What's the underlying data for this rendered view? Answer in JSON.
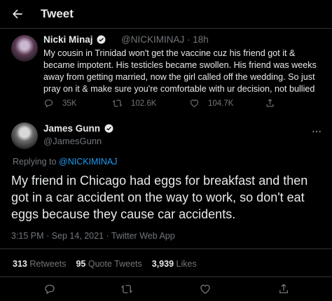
{
  "header": {
    "title": "Tweet",
    "back_icon": "back-arrow-icon"
  },
  "parent_tweet": {
    "author_name": "Nicki Minaj",
    "handle": "@NICKIMINAJ",
    "time": "· 18h",
    "text": "My cousin in Trinidad won't get the vaccine cuz his friend got it & became impotent. His testicles became swollen. His friend was weeks away from getting married, now the girl called off the wedding. So just pray on it & make sure you're comfortable with ur decision, not bullied",
    "replies": "35K",
    "retweets": "102.6K",
    "likes": "104.7K"
  },
  "main_tweet": {
    "author_name": "James Gunn",
    "handle": "@JamesGunn",
    "replying_prefix": "Replying to ",
    "replying_to": "@NICKIMINAJ",
    "text": "My friend in Chicago had eggs for breakfast and then got in a car accident on the way to work, so don't eat eggs because they cause car accidents.",
    "timestamp": "3:15 PM · Sep 14, 2021 · Twitter Web App",
    "retweets_count": "313",
    "retweets_label": "Retweets",
    "quote_count": "95",
    "quote_label": "Quote Tweets",
    "likes_count": "3,939",
    "likes_label": "Likes"
  },
  "colors": {
    "accent": "#1d9bf0",
    "muted": "#71767b",
    "text": "#e7e9ea",
    "background": "#000000"
  }
}
